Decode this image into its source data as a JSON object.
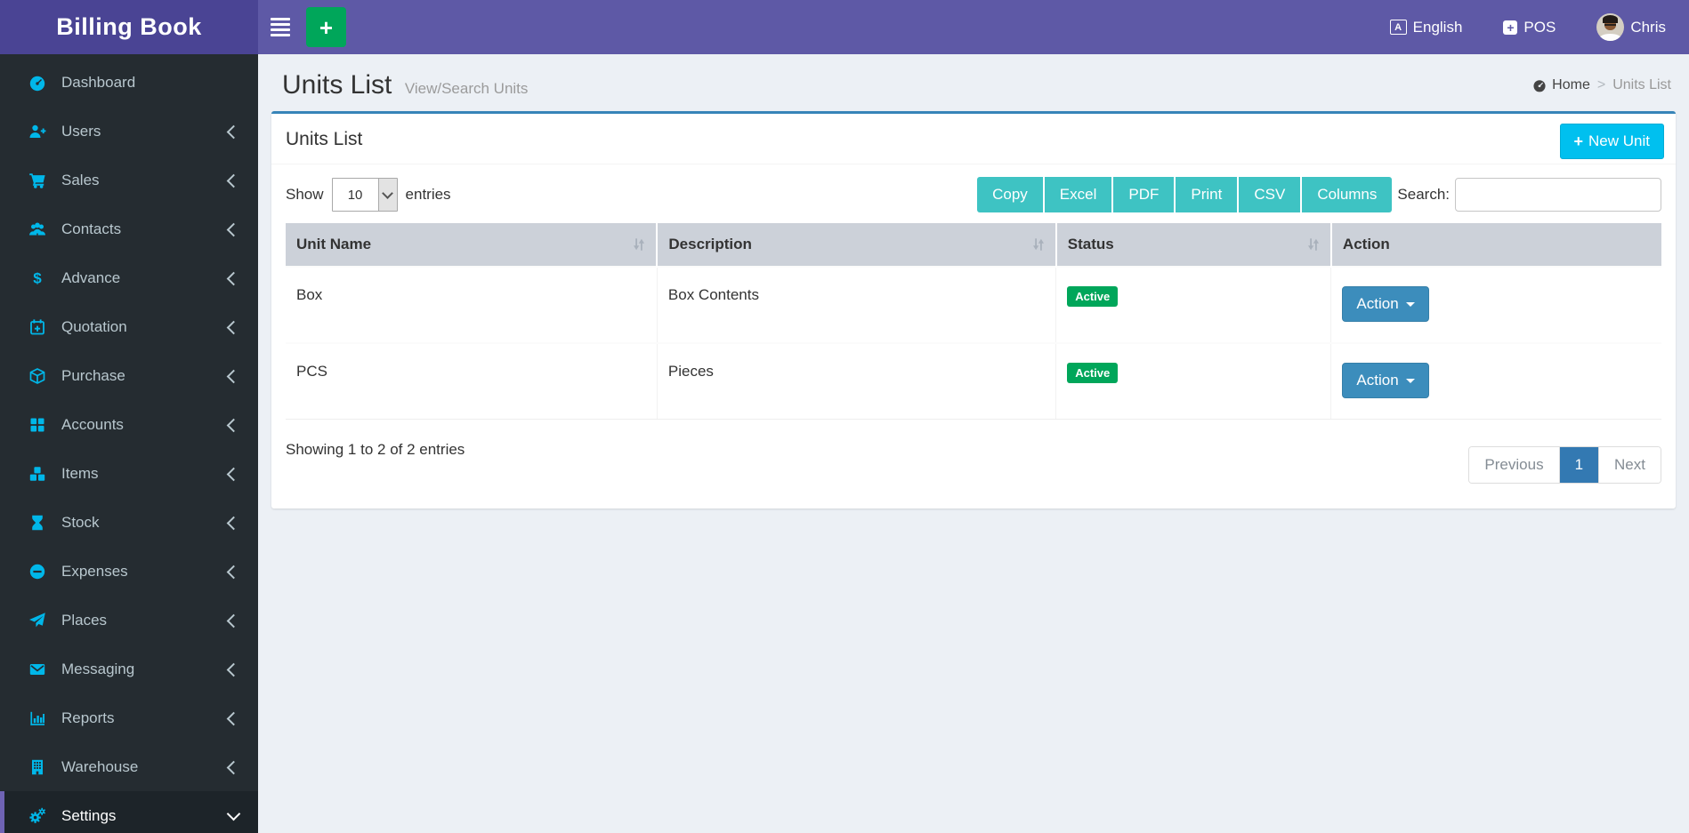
{
  "app": {
    "title": "Billing Book"
  },
  "navbar": {
    "language": {
      "label": "English"
    },
    "pos": {
      "label": "POS"
    },
    "user": {
      "name": "Chris"
    }
  },
  "sidebar": {
    "items": [
      {
        "label": "Dashboard",
        "icon": "dashboard-icon",
        "active": false,
        "expandable": false
      },
      {
        "label": "Users",
        "icon": "user-plus-icon",
        "active": false,
        "expandable": true
      },
      {
        "label": "Sales",
        "icon": "cart-icon",
        "active": false,
        "expandable": true
      },
      {
        "label": "Contacts",
        "icon": "people-icon",
        "active": false,
        "expandable": true
      },
      {
        "label": "Advance",
        "icon": "dollar-icon",
        "active": false,
        "expandable": true
      },
      {
        "label": "Quotation",
        "icon": "calendar-plus-icon",
        "active": false,
        "expandable": true
      },
      {
        "label": "Purchase",
        "icon": "cube-icon",
        "active": false,
        "expandable": true
      },
      {
        "label": "Accounts",
        "icon": "grid-icon",
        "active": false,
        "expandable": true
      },
      {
        "label": "Items",
        "icon": "cubes-icon",
        "active": false,
        "expandable": true
      },
      {
        "label": "Stock",
        "icon": "hourglass-icon",
        "active": false,
        "expandable": true
      },
      {
        "label": "Expenses",
        "icon": "minus-circle-icon",
        "active": false,
        "expandable": true
      },
      {
        "label": "Places",
        "icon": "paper-plane-icon",
        "active": false,
        "expandable": true
      },
      {
        "label": "Messaging",
        "icon": "envelope-icon",
        "active": false,
        "expandable": true
      },
      {
        "label": "Reports",
        "icon": "bar-chart-icon",
        "active": false,
        "expandable": true
      },
      {
        "label": "Warehouse",
        "icon": "building-icon",
        "active": false,
        "expandable": true
      },
      {
        "label": "Settings",
        "icon": "gears-icon",
        "active": true,
        "expanded": true
      }
    ]
  },
  "page": {
    "title": "Units List",
    "subtitle": "View/Search Units",
    "breadcrumb": {
      "home": "Home",
      "separator": ">",
      "current": "Units List"
    }
  },
  "panel": {
    "title": "Units List",
    "new_unit_button": "New Unit"
  },
  "toolbar": {
    "show_label": "Show",
    "page_length": "10",
    "entries_label": "entries",
    "export_buttons": [
      "Copy",
      "Excel",
      "PDF",
      "Print",
      "CSV",
      "Columns"
    ],
    "search_label": "Search:",
    "search_value": ""
  },
  "table": {
    "columns": [
      {
        "label": "Unit Name",
        "sortable": true
      },
      {
        "label": "Description",
        "sortable": true
      },
      {
        "label": "Status",
        "sortable": true
      },
      {
        "label": "Action",
        "sortable": false
      }
    ],
    "rows": [
      {
        "unit_name": "Box",
        "description": "Box Contents",
        "status": "Active",
        "action_label": "Action"
      },
      {
        "unit_name": "PCS",
        "description": "Pieces",
        "status": "Active",
        "action_label": "Action"
      }
    ]
  },
  "footer": {
    "info": "Showing 1 to 2 of 2 entries",
    "pagination": {
      "previous": "Previous",
      "current_page": "1",
      "next": "Next"
    }
  },
  "colors": {
    "navbar": "#5e59a6",
    "logo_bg": "#4a4494",
    "sidebar_bg": "#252c31",
    "sidebar_icon": "#00b7e9",
    "active_item_border": "#6f63b4",
    "panel_top_border": "#3784b8",
    "export_button": "#3ec3c3",
    "new_unit_button": "#00c0ef",
    "status_active": "#00a65a",
    "add_button": "#00a65a",
    "action_button": "#3c8dbc",
    "pagination_active": "#3379b2",
    "table_header_bg": "#ccd1d9",
    "content_bg": "#ecf0f5"
  }
}
